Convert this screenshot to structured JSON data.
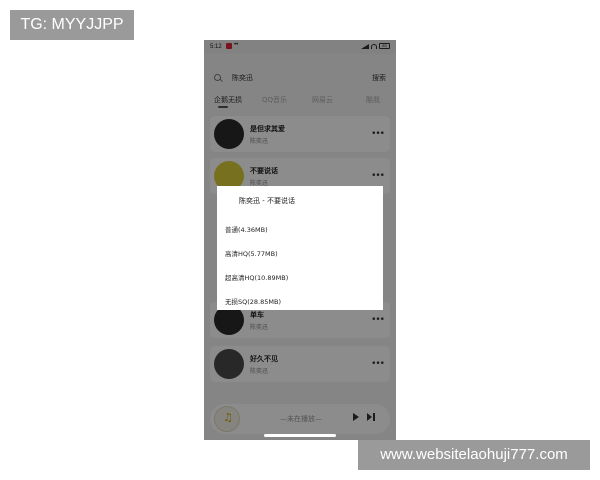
{
  "overlay_texts": {
    "tg_label": "TG: MYYJJPP",
    "watermark": "www.websitelaohuji777.com"
  },
  "status_bar": {
    "time": "5:12",
    "dots": "••",
    "battery": "85"
  },
  "search": {
    "value": "陈奕迅",
    "button_label": "搜索"
  },
  "tabs": [
    {
      "label": "企鹅无损",
      "active": true
    },
    {
      "label": "QQ音乐",
      "active": false
    },
    {
      "label": "网易云",
      "active": false
    },
    {
      "label": "酷我",
      "active": false
    }
  ],
  "songs": [
    {
      "title": "是但求其爱",
      "artist": "陈奕迅"
    },
    {
      "title": "不要说话",
      "artist": "陈奕迅"
    },
    {
      "title": "单车",
      "artist": "陈奕迅"
    },
    {
      "title": "好久不见",
      "artist": "陈奕迅"
    }
  ],
  "dialog": {
    "title": "陈奕迅 - 不要说话",
    "options": [
      "普通(4.36MB)",
      "高清HQ(5.77MB)",
      "超高清HQ(10.89MB)",
      "无损SQ(28.85MB)"
    ]
  },
  "player": {
    "title": "—未在播放—"
  },
  "colors": {
    "status_app_icon": "#d9263a",
    "overlay": "rgba(0,0,0,0.45)",
    "player_note": "#d59a00"
  }
}
